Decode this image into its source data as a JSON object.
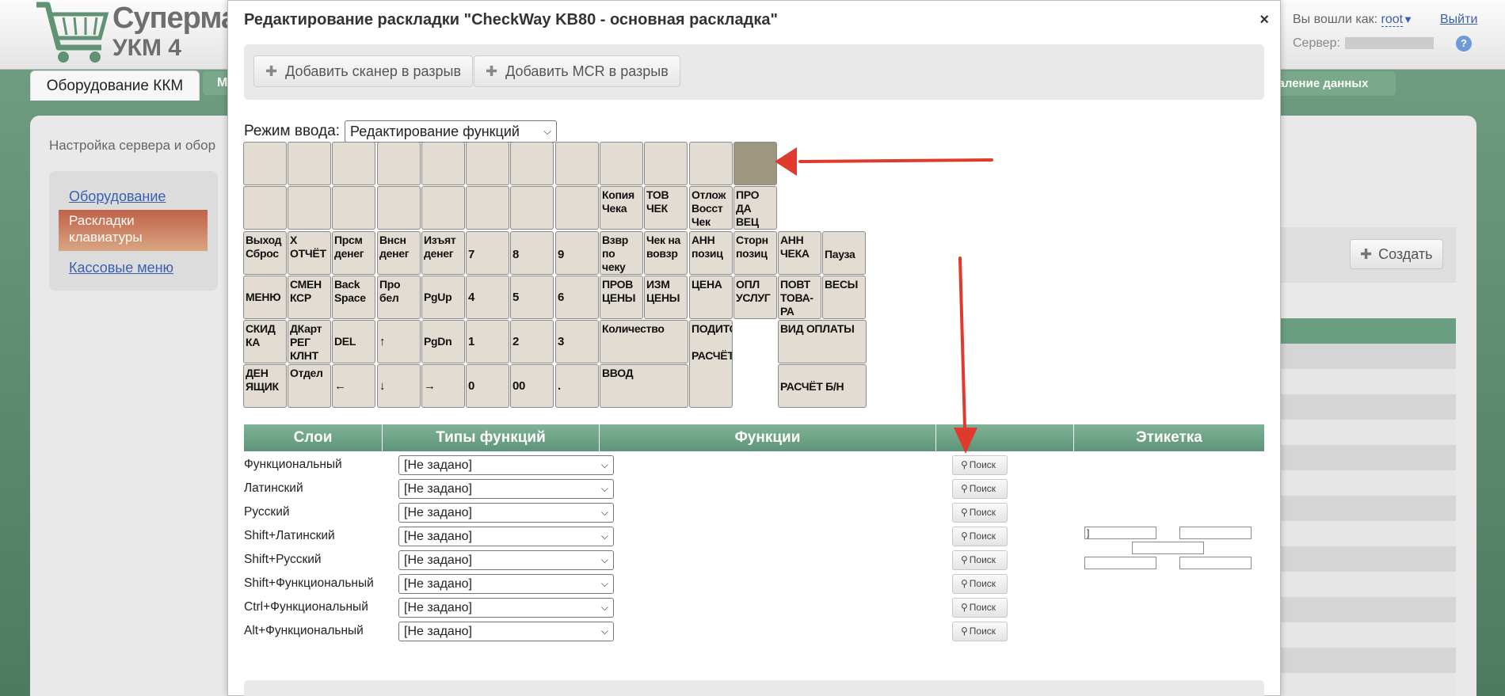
{
  "app": {
    "logo_line1": "Супермаг",
    "logo_line2": "УКМ 4",
    "user_label": "Вы вошли как:",
    "user_name": "root",
    "user_caret": "▼",
    "logout": "Выйти",
    "server_label": "Сервер:",
    "help": "?"
  },
  "tabs": {
    "active": "Оборудование ККМ",
    "next_partial": "М",
    "delete_partial": "даление данных"
  },
  "page": {
    "breadcrumb": "Настройка сервера и обор",
    "create_button": "Создать"
  },
  "sidebar": {
    "items": [
      "Оборудование",
      "Раскладки клавиатуры",
      "Кассовые меню"
    ]
  },
  "dialog": {
    "title": "Редактирование раскладки \"CheckWay KB80 - основная раскладка\"",
    "close": "×",
    "add_scanner": "Добавить сканер в разрыв",
    "add_mcr": "Добавить MCR в разрыв",
    "mode_label": "Режим ввода:",
    "mode_value": "Редактирование функций"
  },
  "keyboard": {
    "keys": [
      "",
      "",
      "",
      "",
      "",
      "",
      "",
      "",
      "",
      "",
      "",
      "",
      "",
      "",
      "",
      "",
      "",
      "",
      "",
      "",
      "Копия Чека",
      "ТОВ ЧЕК",
      "Отлож Восст Чек",
      "ПРО ДА ВЕЦ",
      "Выход Сброс",
      "Х ОТЧЁТ",
      "Прсм денег",
      "Внсн денег",
      "Изъят денег",
      "7",
      "8",
      "9",
      "Взвр по чеку",
      "Чек на вовзр",
      "АНН позиц",
      "Сторн позиц",
      "АНН ЧЕКА",
      "Пауза",
      "МЕНЮ",
      "СМЕН КСР",
      "Back Space",
      "Про бел",
      "PgUp",
      "4",
      "5",
      "6",
      "ПРОВ ЦЕНЫ",
      "ИЗМ ЦЕНЫ",
      "ЦЕНА",
      "ОПЛ УСЛУГ",
      "ПОВТ ТОВА- РА",
      "ВЕСЫ",
      "СКИД КА",
      "ДКарт РЕГ КЛНТ",
      "DEL",
      "↑",
      "PgDn",
      "1",
      "2",
      "3",
      "Количество",
      "ПОДИТОГ\n\nРАСЧЁТ",
      "ВИД ОПЛАТЫ",
      "ДЕН ЯЩИК",
      "Отдел",
      "←",
      "↓",
      "→",
      "0",
      "00",
      ".",
      "ВВОД",
      "\nРАСЧЁТ Б/Н"
    ]
  },
  "table": {
    "headers": [
      "Слои",
      "Типы функций",
      "Функции",
      "",
      "Этикетка"
    ],
    "rows": [
      {
        "layer": "Функциональный",
        "type": "[Не задано]",
        "search": "Поиск"
      },
      {
        "layer": "Латинский",
        "type": "[Не задано]",
        "search": "Поиск"
      },
      {
        "layer": "Русский",
        "type": "[Не задано]",
        "search": "Поиск"
      },
      {
        "layer": "Shift+Латинский",
        "type": "[Не задано]",
        "search": "Поиск"
      },
      {
        "layer": "Shift+Русский",
        "type": "[Не задано]",
        "search": "Поиск"
      },
      {
        "layer": "Shift+Функциональный",
        "type": "[Не задано]",
        "search": "Поиск"
      },
      {
        "layer": "Ctrl+Функциональный",
        "type": "[Не задано]",
        "search": "Поиск"
      },
      {
        "layer": "Alt+Функциональный",
        "type": "[Не задано]",
        "search": "Поиск"
      }
    ],
    "label_first_value": "]"
  },
  "colors": {
    "header_green": "#5e9479",
    "key_bg": "#e3dcd3",
    "key_selected": "#9e9780",
    "sidebar_active": "#c0624a",
    "annotation_arrow": "#e03a2f"
  }
}
